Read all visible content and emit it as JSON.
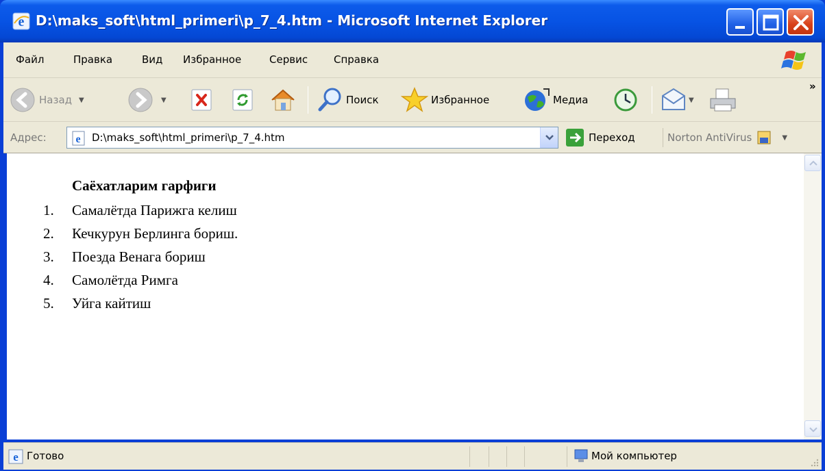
{
  "window": {
    "title": "D:\\maks_soft\\html_primeri\\p_7_4.htm - Microsoft Internet Explorer",
    "controls": [
      "minimize-icon",
      "maximize-icon",
      "close-icon"
    ]
  },
  "menu": {
    "items": [
      "Файл",
      "Правка",
      "Вид",
      "Избранное",
      "Сервис",
      "Справка"
    ]
  },
  "toolbar": {
    "back_label": "Назад",
    "search_label": "Поиск",
    "favorites_label": "Избранное",
    "media_label": "Медиа",
    "chevron": "»"
  },
  "address": {
    "label": "Адрес:",
    "value": "D:\\maks_soft\\html_primeri\\p_7_4.htm",
    "go_label": "Переход",
    "norton_label": "Norton AntiVirus"
  },
  "page": {
    "heading": "Саёхатларим гарфиги",
    "items": [
      "Самалётда Парижга келиш",
      "Кечкурун Берлинга бориш.",
      "Поезда Венага бориш",
      "Самолётда Римга",
      "Уйга кайтиш"
    ],
    "numbers": [
      "1.",
      "2.",
      "3.",
      "4.",
      "5."
    ]
  },
  "status": {
    "text": "Готово",
    "zone": "Мой компьютер"
  },
  "colors": {
    "title_bar": "#0753e4",
    "chrome": "#ece9d8",
    "close_button": "#d8411a"
  }
}
